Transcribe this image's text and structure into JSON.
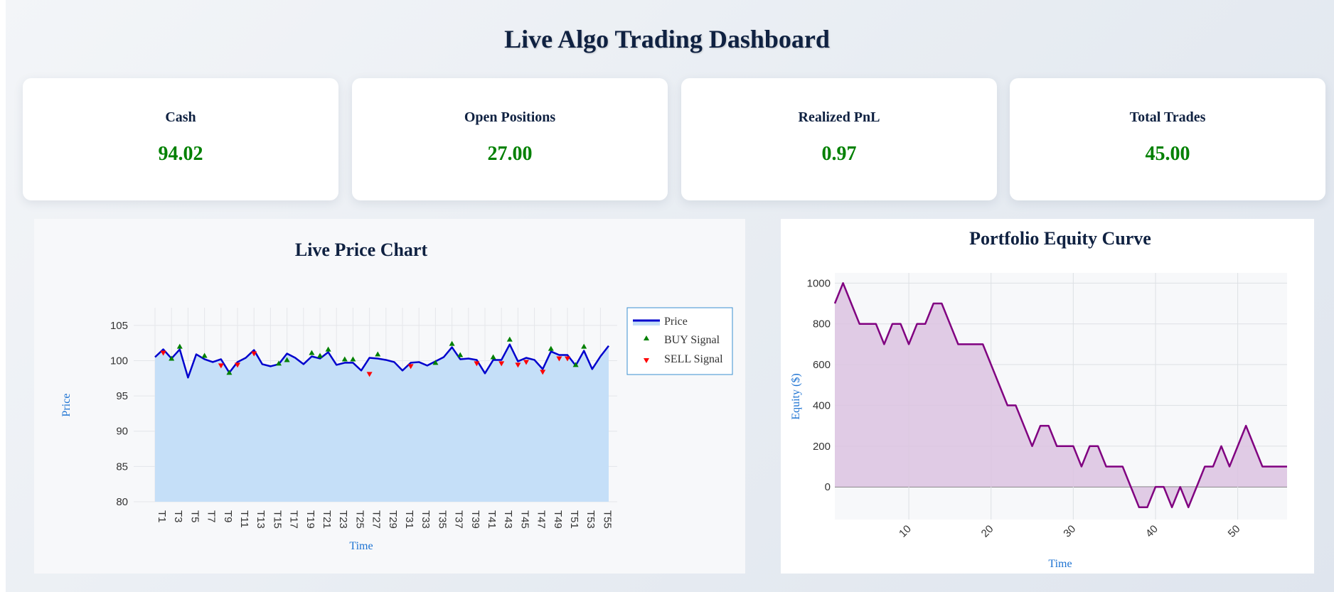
{
  "dashboard": {
    "title": "Live Algo Trading Dashboard"
  },
  "cards": [
    {
      "label": "Cash",
      "value": "94.02"
    },
    {
      "label": "Open Positions",
      "value": "27.00"
    },
    {
      "label": "Realized PnL",
      "value": "0.97"
    },
    {
      "label": "Total Trades",
      "value": "45.00"
    }
  ],
  "colors": {
    "value_green": "#008000",
    "price_line": "#0000cd",
    "price_fill": "#c5dff8",
    "buy": "#008000",
    "sell": "#ff0000",
    "equity_line": "#800080",
    "equity_fill": "#dcc3e0",
    "axis_label": "#1e73d2"
  },
  "chart_data": [
    {
      "type": "line",
      "title": "Live Price Chart",
      "xlabel": "Time",
      "ylabel": "Price",
      "ylim": [
        80,
        107.5
      ],
      "yticks": [
        80,
        85,
        90,
        95,
        100,
        105
      ],
      "categories": [
        "T1",
        "T2",
        "T3",
        "T4",
        "T5",
        "T6",
        "T7",
        "T8",
        "T9",
        "T10",
        "T11",
        "T12",
        "T13",
        "T14",
        "T15",
        "T16",
        "T17",
        "T18",
        "T19",
        "T20",
        "T21",
        "T22",
        "T23",
        "T24",
        "T25",
        "T26",
        "T27",
        "T28",
        "T29",
        "T30",
        "T31",
        "T32",
        "T33",
        "T34",
        "T35",
        "T36",
        "T37",
        "T38",
        "T39",
        "T40",
        "T41",
        "T42",
        "T43",
        "T44",
        "T45",
        "T46",
        "T47",
        "T48",
        "T49",
        "T50",
        "T51",
        "T52",
        "T53",
        "T54",
        "T55",
        "T56"
      ],
      "xtick_labels": [
        "T1",
        "T3",
        "T5",
        "T7",
        "T9",
        "T11",
        "T13",
        "T15",
        "T17",
        "T19",
        "T21",
        "T23",
        "T25",
        "T27",
        "T29",
        "T31",
        "T33",
        "T35",
        "T37",
        "T39",
        "T41",
        "T43",
        "T45",
        "T47",
        "T49",
        "T51",
        "T53",
        "T55"
      ],
      "series": [
        {
          "name": "Price",
          "values": [
            100.5,
            101.6,
            100.3,
            101.6,
            97.6,
            100.9,
            100.2,
            99.8,
            100.2,
            98.3,
            99.8,
            100.4,
            101.5,
            99.5,
            99.2,
            99.5,
            101.0,
            100.4,
            99.5,
            100.6,
            100.3,
            101.2,
            99.4,
            99.7,
            99.7,
            98.6,
            100.4,
            100.3,
            100.1,
            99.8,
            98.6,
            99.7,
            99.8,
            99.3,
            99.9,
            100.5,
            101.9,
            100.2,
            100.3,
            100.1,
            98.2,
            100.1,
            100.1,
            102.3,
            99.9,
            100.4,
            100.1,
            98.8,
            101.3,
            100.8,
            100.8,
            99.3,
            101.4,
            98.8,
            100.6,
            102.1
          ]
        },
        {
          "name": "BUY Signal",
          "points": [
            [
              3,
              100.3
            ],
            [
              4,
              102.0
            ],
            [
              7,
              100.7
            ],
            [
              10,
              98.3
            ],
            [
              16,
              99.6
            ],
            [
              17,
              100.1
            ],
            [
              20,
              101.1
            ],
            [
              21,
              100.7
            ],
            [
              22,
              101.6
            ],
            [
              24,
              100.2
            ],
            [
              25,
              100.2
            ],
            [
              28,
              100.9
            ],
            [
              35,
              99.7
            ],
            [
              37,
              102.4
            ],
            [
              38,
              100.8
            ],
            [
              42,
              100.5
            ],
            [
              44,
              103.0
            ],
            [
              49,
              101.7
            ],
            [
              52,
              99.4
            ],
            [
              53,
              102.0
            ]
          ]
        },
        {
          "name": "SELL Signal",
          "points": [
            [
              2,
              101.1
            ],
            [
              9,
              99.3
            ],
            [
              11,
              99.4
            ],
            [
              13,
              101.0
            ],
            [
              27,
              98.1
            ],
            [
              32,
              99.2
            ],
            [
              40,
              99.6
            ],
            [
              43,
              99.6
            ],
            [
              45,
              99.4
            ],
            [
              46,
              99.8
            ],
            [
              48,
              98.4
            ],
            [
              50,
              100.3
            ],
            [
              51,
              100.3
            ]
          ]
        }
      ],
      "legend": "right",
      "grid": true
    },
    {
      "type": "area",
      "title": "Portfolio Equity Curve",
      "xlabel": "Time",
      "ylabel": "Equity ($)",
      "xlim": [
        1,
        56
      ],
      "ylim": [
        -160,
        1050
      ],
      "xticks": [
        10,
        20,
        30,
        40,
        50
      ],
      "yticks": [
        0,
        200,
        400,
        600,
        800,
        1000
      ],
      "x": [
        1,
        2,
        3,
        4,
        5,
        6,
        7,
        8,
        9,
        10,
        11,
        12,
        13,
        14,
        15,
        16,
        17,
        18,
        19,
        20,
        21,
        22,
        23,
        24,
        25,
        26,
        27,
        28,
        29,
        30,
        31,
        32,
        33,
        34,
        35,
        36,
        37,
        38,
        39,
        40,
        41,
        42,
        43,
        44,
        45,
        46,
        47,
        48,
        49,
        50,
        51,
        52,
        53,
        54,
        55,
        56
      ],
      "values": [
        900,
        1000,
        900,
        800,
        800,
        800,
        700,
        800,
        800,
        700,
        800,
        800,
        900,
        900,
        800,
        700,
        700,
        700,
        700,
        600,
        500,
        400,
        400,
        300,
        200,
        300,
        300,
        200,
        200,
        200,
        100,
        200,
        200,
        100,
        100,
        100,
        0,
        -100,
        -100,
        0,
        0,
        -100,
        0,
        -100,
        0,
        100,
        100,
        200,
        100,
        200,
        300,
        200,
        100,
        100,
        100,
        100
      ],
      "grid": true
    }
  ]
}
